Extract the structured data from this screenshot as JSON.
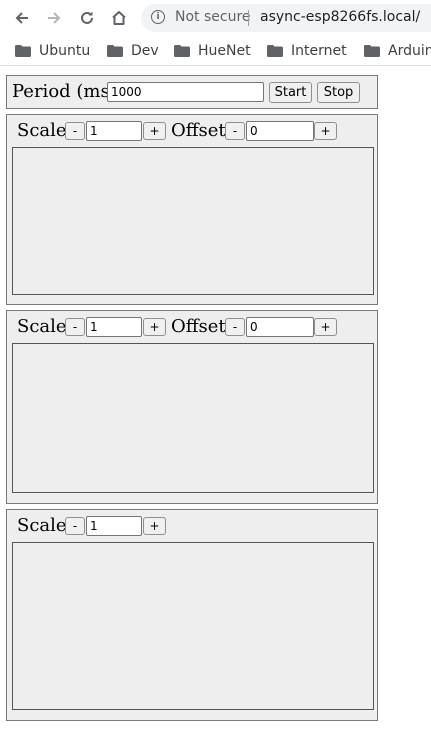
{
  "browser": {
    "security_label": "Not secure",
    "url": "async-esp8266fs.local/",
    "bookmarks": [
      "Ubuntu",
      "Dev",
      "HueNet",
      "Internet",
      "Arduino"
    ]
  },
  "controls": {
    "period_label": "Period (ms):",
    "period_value": "1000",
    "start_label": "Start",
    "stop_label": "Stop"
  },
  "charts": [
    {
      "scale_label": "Scale:",
      "scale_value": "1",
      "offset_label": "Offset:",
      "offset_value": "0",
      "minus": "-",
      "plus": "+"
    },
    {
      "scale_label": "Scale:",
      "scale_value": "1",
      "offset_label": "Offset:",
      "offset_value": "0",
      "minus": "-",
      "plus": "+"
    },
    {
      "scale_label": "Scale:",
      "scale_value": "1",
      "minus": "-",
      "plus": "+"
    }
  ]
}
